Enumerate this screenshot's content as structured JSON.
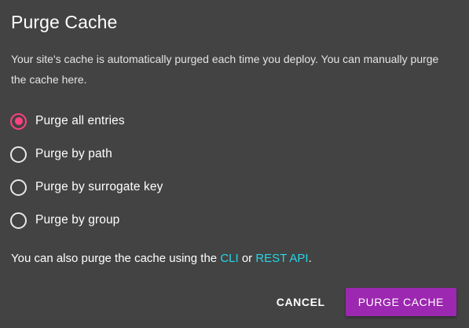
{
  "dialog": {
    "title": "Purge Cache",
    "description": "Your site's cache is automatically purged each time you deploy. You can manually purge the cache here.",
    "options": [
      {
        "label": "Purge all entries",
        "selected": true
      },
      {
        "label": "Purge by path",
        "selected": false
      },
      {
        "label": "Purge by surrogate key",
        "selected": false
      },
      {
        "label": "Purge by group",
        "selected": false
      }
    ],
    "footnote": {
      "prefix": "You can also purge the cache using the ",
      "link_cli": "CLI",
      "middle": " or ",
      "link_api": "REST API",
      "suffix": "."
    },
    "actions": {
      "cancel_label": "CANCEL",
      "confirm_label": "PURGE CACHE"
    }
  },
  "colors": {
    "background": "#434343",
    "radio_selected": "#ff4181",
    "link": "#26d5e6",
    "primary_button": "#9c27b0"
  },
  "icons": {
    "radio_selected": "radio-checked-icon",
    "radio_unselected": "radio-unchecked-icon"
  }
}
